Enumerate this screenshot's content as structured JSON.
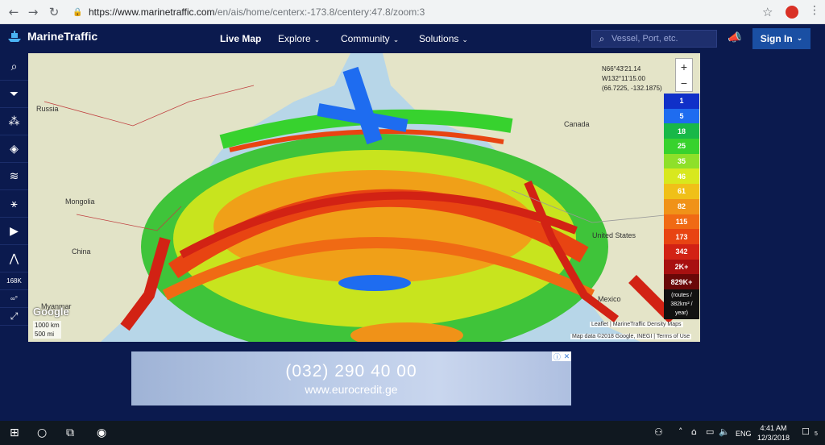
{
  "browser": {
    "url_host": "https://www.marinetraffic.com",
    "url_path": "/en/ais/home/centerx:-173.8/centery:47.8/zoom:3",
    "back_icon": "arrow-left-icon",
    "forward_icon": "arrow-right-icon",
    "reload_icon": "reload-icon"
  },
  "header": {
    "brand": "MarineTraffic",
    "nav": [
      {
        "label": "Live Map"
      },
      {
        "label": "Explore"
      },
      {
        "label": "Community"
      },
      {
        "label": "Solutions"
      }
    ],
    "search_placeholder": "Vessel, Port, etc.",
    "signin_label": "Sign In"
  },
  "leftbar": {
    "tools": [
      "search-icon",
      "filter-icon",
      "cluster-icon",
      "layers-icon",
      "wind-icon",
      "routes-icon",
      "play-icon",
      "measure-icon"
    ],
    "vessel_count": "168K",
    "vessel_mode": "∞°"
  },
  "map": {
    "labels": {
      "russia": "Russia",
      "mongolia": "Mongolia",
      "china": "China",
      "myanmar": "Myanmar",
      "canada": "Canada",
      "united_states": "United States",
      "mexico": "Mexico"
    },
    "coords": {
      "lat": "N66°43'21.14",
      "lon": "W132°11'15.00",
      "decimal": "(66.7225, -132.1875)"
    },
    "legend": {
      "rows": [
        {
          "label": "1",
          "color": "#1030c8"
        },
        {
          "label": "5",
          "color": "#1e6cf0"
        },
        {
          "label": "18",
          "color": "#18b848"
        },
        {
          "label": "25",
          "color": "#37d22e"
        },
        {
          "label": "35",
          "color": "#8ee02a"
        },
        {
          "label": "46",
          "color": "#d8e81e"
        },
        {
          "label": "61",
          "color": "#f0c018"
        },
        {
          "label": "82",
          "color": "#f09218"
        },
        {
          "label": "115",
          "color": "#f06a14"
        },
        {
          "label": "173",
          "color": "#e84412"
        },
        {
          "label": "342",
          "color": "#d22214"
        },
        {
          "label": "2K+",
          "color": "#a81010"
        },
        {
          "label": "829K+",
          "color": "#6a0808"
        }
      ],
      "footer": [
        "(routes /",
        "382km² /",
        "year)"
      ]
    },
    "google_logo": "Google",
    "scale_km": "1000 km",
    "scale_mi": "500 mi",
    "attribution": "Leaflet | MarineTraffic Density Maps",
    "map_data": "Map data ©2018 Google, INEGI | Terms of Use"
  },
  "ad": {
    "phone": "(032) 290 40 00",
    "site": "www.eurocredit.ge"
  },
  "taskbar": {
    "lang": "ENG",
    "time": "4:41 AM",
    "date": "12/3/2018",
    "notifications": "5"
  }
}
